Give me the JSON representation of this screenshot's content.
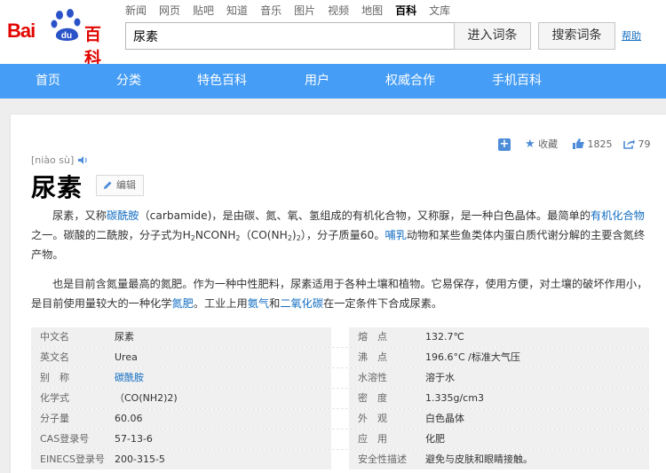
{
  "header": {
    "logo": {
      "left": "Bai",
      "paw_text": "du",
      "right": "百科"
    },
    "nav_links": [
      "新闻",
      "网页",
      "贴吧",
      "知道",
      "音乐",
      "图片",
      "视频",
      "地图",
      "百科",
      "文库"
    ],
    "active_nav": "百科",
    "search_value": "尿素",
    "enter_button": "进入词条",
    "search_button": "搜索词条",
    "help_link": "帮助"
  },
  "main_nav": [
    "首页",
    "分类",
    "特色百科",
    "用户",
    "权威合作",
    "手机百科"
  ],
  "entry": {
    "pinyin": "[niào sù]",
    "title": "尿素",
    "edit_label": "编辑",
    "collect_label": "收藏",
    "like_count": "1825",
    "share_count": "79"
  },
  "paragraphs": {
    "p1": {
      "a": "尿素，又称",
      "link1": "碳酰胺",
      "b": "（carbamide)，是由碳、氮、氧、氢组成的有机化合物，又称脲，是一种白色晶体。最简单的",
      "link2": "有机化合物",
      "c": "之一。碳酸的二酰胺，分子式为H",
      "sub1": "2",
      "d": "NCONH",
      "sub2": "2",
      "e": "（CO(NH",
      "sub3": "2",
      "f": ")",
      "sub4": "2",
      "g": "），分子质量60。",
      "link3": "哺乳",
      "h": "动物和某些鱼类体内蛋白质代谢分解的主要含氮终产物。"
    },
    "p2": {
      "a": "也是目前含氮量最高的氮肥。作为一种中性肥料，尿素适用于各种土壤和植物。它易保存，使用方便，对土壤的破坏作用小，是目前使用量较大的一种化学",
      "link1": "氮肥",
      "b": "。工业上用",
      "link2": "氨气",
      "c": "和",
      "link3": "二氧化碳",
      "d": "在一定条件下合成尿素。"
    }
  },
  "info_rows": [
    {
      "k1": "中文名",
      "v1": "尿素",
      "k2": "熔　点",
      "v2": "132.7℃"
    },
    {
      "k1": "英文名",
      "v1": "Urea",
      "k2": "沸　点",
      "v2": "196.6°C /标准大气压"
    },
    {
      "k1": "别　称",
      "v1": "碳酰胺",
      "k2": "水溶性",
      "v2": "溶于水"
    },
    {
      "k1": "化学式",
      "v1": "（CO(NH2)2)",
      "k2": "密　度",
      "v2": "1.335g/cm3"
    },
    {
      "k1": "分子量",
      "v1": "60.06",
      "k2": "外　观",
      "v2": "白色晶体"
    },
    {
      "k1": "CAS登录号",
      "v1": "57-13-6",
      "k2": "应　用",
      "v2": "化肥"
    },
    {
      "k1": "EINECS登录号",
      "v1": "200-315-5",
      "k2": "安全性描述",
      "v2": "避免与皮肤和眼睛接触。"
    }
  ],
  "colors": {
    "brand_red": "#e10601",
    "nav_blue": "#459df5",
    "link_blue": "#136ec2"
  }
}
